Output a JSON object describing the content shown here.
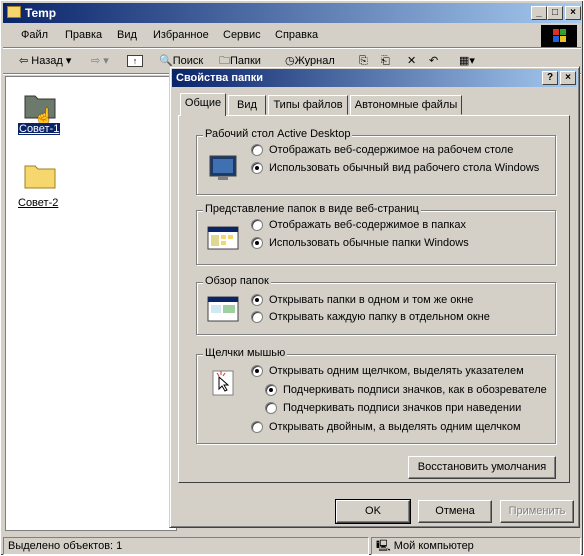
{
  "explorer": {
    "title": "Temp",
    "menu": [
      "Файл",
      "Правка",
      "Вид",
      "Избранное",
      "Сервис",
      "Справка"
    ],
    "toolbar": {
      "back": "Назад",
      "search": "Поиск",
      "folders": "Папки",
      "history": "Журнал"
    },
    "files": [
      {
        "name": "Совет-1",
        "selected": true
      },
      {
        "name": "Совет-2",
        "selected": false
      }
    ],
    "status": {
      "selected": "Выделено объектов: 1",
      "location": "Мой компьютер"
    }
  },
  "dialog": {
    "title": "Свойства папки",
    "help": "?",
    "tabs": [
      "Общие",
      "Вид",
      "Типы файлов",
      "Автономные файлы"
    ],
    "active_tab": "Общие",
    "groups": {
      "desktop": {
        "title": "Рабочий стол Active Desktop",
        "options": [
          {
            "label": "Отображать веб-содержимое на рабочем столе",
            "selected": false
          },
          {
            "label": "Использовать обычный вид рабочего стола Windows",
            "selected": true
          }
        ]
      },
      "webview": {
        "title": "Представление папок в виде веб-страниц",
        "options": [
          {
            "label": "Отображать веб-содержимое в папках",
            "selected": false
          },
          {
            "label": "Использовать обычные папки Windows",
            "selected": true
          }
        ]
      },
      "browse": {
        "title": "Обзор папок",
        "options": [
          {
            "label": "Открывать папки в одном и том же окне",
            "selected": true
          },
          {
            "label": "Открывать каждую папку в отдельном окне",
            "selected": false
          }
        ]
      },
      "click": {
        "title": "Щелчки мышью",
        "options": [
          {
            "label": "Открывать одним щелчком, выделять указателем",
            "selected": true
          },
          {
            "label": "Подчеркивать подписи значков, как в обозревателе",
            "selected": true,
            "sub": true
          },
          {
            "label": "Подчеркивать подписи значков при наведении",
            "selected": false,
            "sub": true
          },
          {
            "label": "Открывать двойным, а выделять одним щелчком",
            "selected": false
          }
        ]
      }
    },
    "restore_button": "Восстановить умолчания",
    "buttons": {
      "ok": "OK",
      "cancel": "Отмена",
      "apply": "Применить"
    }
  }
}
